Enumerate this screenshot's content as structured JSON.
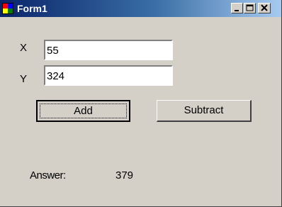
{
  "window": {
    "title": "Form1"
  },
  "caption_buttons": {
    "minimize": "minimize-icon",
    "maximize": "maximize-icon",
    "close": "close-icon"
  },
  "form": {
    "x_label": "X",
    "x_value": "55",
    "y_label": "Y",
    "y_value": "324",
    "add_label": "Add",
    "subtract_label": "Subtract",
    "answer_label": "Answer:",
    "answer_value": "379"
  },
  "colors": {
    "title_start": "#0a246a",
    "title_end": "#a6caf0",
    "face": "#d4d0c8"
  }
}
